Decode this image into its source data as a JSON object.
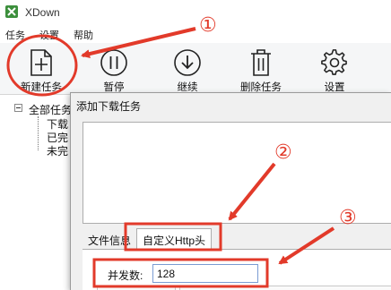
{
  "window": {
    "title": "XDown"
  },
  "menu": {
    "items": [
      "任务",
      "设置",
      "帮助"
    ]
  },
  "toolbar": {
    "new_task": "新建任务",
    "pause": "暂停",
    "resume": "继续",
    "delete_task": "删除任务",
    "settings": "设置"
  },
  "tree": {
    "root": "全部任务",
    "children": [
      "下载",
      "已完",
      "未完"
    ]
  },
  "dialog": {
    "title": "添加下载任务",
    "tabs": [
      "文件信息",
      "自定义Http头"
    ],
    "concurrency_label": "并发数:",
    "concurrency_value": "128"
  },
  "annotations": {
    "steps": [
      "①",
      "②",
      "③"
    ],
    "color": "#e23a2a"
  },
  "colors": {
    "toolbar_bg": "#f5f6f7",
    "dialog_bg": "#f0f0f0",
    "input_border": "#7a9cd3"
  }
}
